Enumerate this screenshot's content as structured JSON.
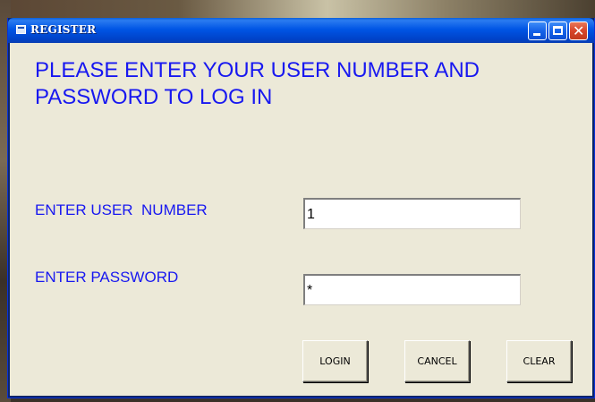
{
  "window": {
    "title": "REGISTER",
    "controls": {
      "minimize_icon": "minimize-icon",
      "maximize_icon": "maximize-icon",
      "close_icon": "close-icon",
      "close_glyph": "✕"
    }
  },
  "form": {
    "heading": "PLEASE ENTER YOUR USER NUMBER AND PASSWORD TO LOG IN",
    "user_label": "ENTER USER  NUMBER",
    "user_value": "1",
    "password_label": "ENTER PASSWORD",
    "password_value": "*"
  },
  "buttons": {
    "login": "LOGIN",
    "cancel": "CANCEL",
    "clear": "CLEAR"
  },
  "colors": {
    "label_text": "#1818f0",
    "window_bg": "#ece9d8",
    "titlebar": "#0055e5"
  }
}
